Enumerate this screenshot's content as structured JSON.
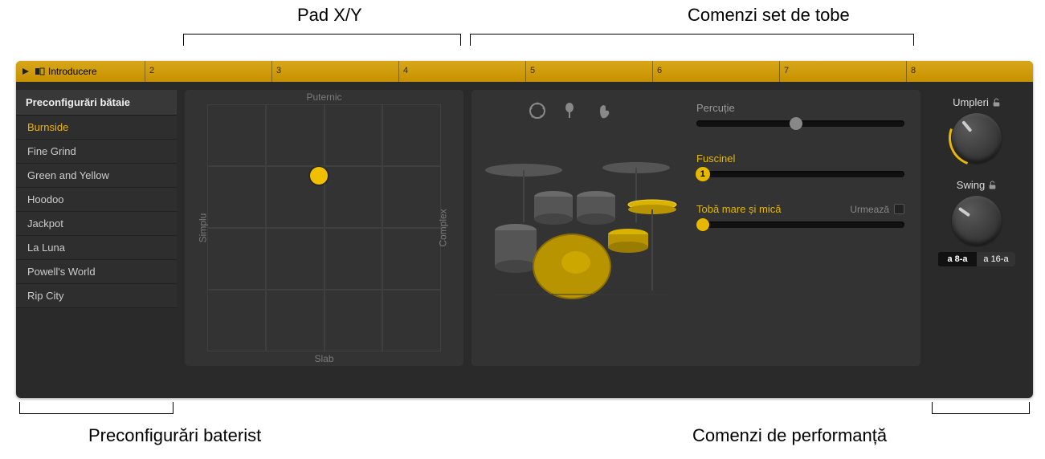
{
  "annotations": {
    "top_xy": "Pad X/Y",
    "top_kit": "Comenzi set de tobe",
    "bot_presets": "Preconfigurări baterist",
    "bot_perf": "Comenzi de performanță"
  },
  "ruler": {
    "region_name": "Introducere",
    "ticks": [
      "2",
      "3",
      "4",
      "5",
      "6",
      "7",
      "8"
    ]
  },
  "presets": {
    "header": "Preconfigurări bătaie",
    "items": [
      "Burnside",
      "Fine Grind",
      "Green and Yellow",
      "Hoodoo",
      "Jackpot",
      "La Luna",
      "Powell's World",
      "Rip City"
    ],
    "selected_index": 0
  },
  "xy": {
    "top": "Puternic",
    "bottom": "Slab",
    "left": "Simplu",
    "right": "Complex",
    "puck": {
      "x_pct": 45,
      "y_pct": 28
    }
  },
  "kit": {
    "percussion_label": "Percuție",
    "percussion_value_pct": 48,
    "hihat_label": "Fuscinel",
    "hihat_badge": "1",
    "hihat_value_pct": 3,
    "kick_snare_label": "Tobă mare și mică",
    "kick_snare_value_pct": 3,
    "follow_label": "Urmează"
  },
  "perf": {
    "fills_label": "Umpleri",
    "swing_label": "Swing",
    "note_a": "a 8-a",
    "note_b": "a 16-a"
  },
  "colors": {
    "accent": "#e6b800"
  }
}
